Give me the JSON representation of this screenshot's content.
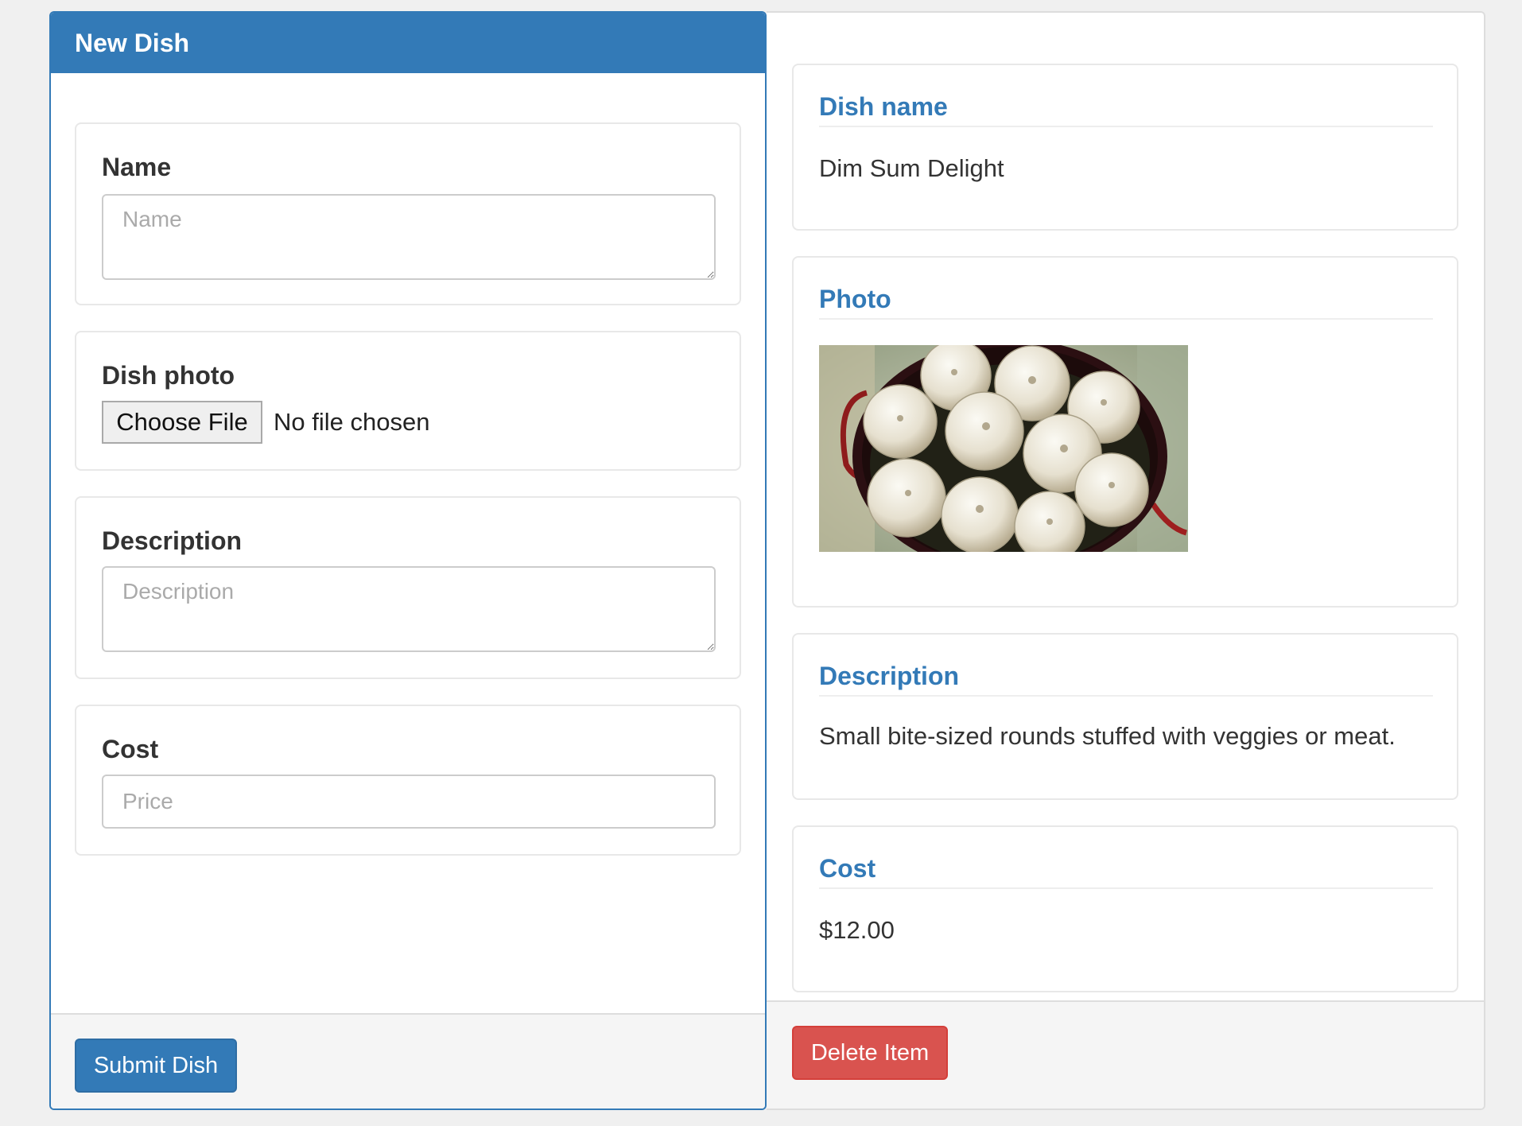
{
  "form": {
    "heading": "New Dish",
    "name": {
      "label": "Name",
      "placeholder": "Name",
      "value": ""
    },
    "photo": {
      "label": "Dish photo",
      "button_label": "Choose File",
      "status": "No file chosen"
    },
    "description": {
      "label": "Description",
      "placeholder": "Description",
      "value": ""
    },
    "cost": {
      "label": "Cost",
      "placeholder": "Price",
      "value": ""
    },
    "submit_label": "Submit Dish"
  },
  "detail": {
    "name": {
      "title": "Dish name",
      "value": "Dim Sum Delight"
    },
    "photo": {
      "title": "Photo",
      "alt": "Dim sum buns in a bamboo steamer"
    },
    "description": {
      "title": "Description",
      "value": "Small bite-sized rounds stuffed with veggies or meat."
    },
    "cost": {
      "title": "Cost",
      "value": "$12.00"
    },
    "delete_label": "Delete Item"
  },
  "colors": {
    "primary": "#337ab7",
    "danger": "#d9534f",
    "page_background": "#f0f0f0"
  }
}
